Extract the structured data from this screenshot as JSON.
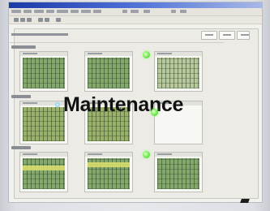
{
  "overlay": {
    "text": "Maintenance"
  },
  "icons": {
    "bullet": "circle-bullet-icon",
    "status_led": "green-status-led-icon",
    "cursor": "mouse-pointer-icon"
  },
  "colors": {
    "titlebar": "#1a3aa8",
    "plot_green": "#86a86c",
    "led_green": "#7ef05c",
    "overlay_text": "#111111"
  },
  "status_leds": [
    {
      "state": "ok"
    },
    {
      "state": "ok"
    },
    {
      "state": "ok"
    }
  ]
}
